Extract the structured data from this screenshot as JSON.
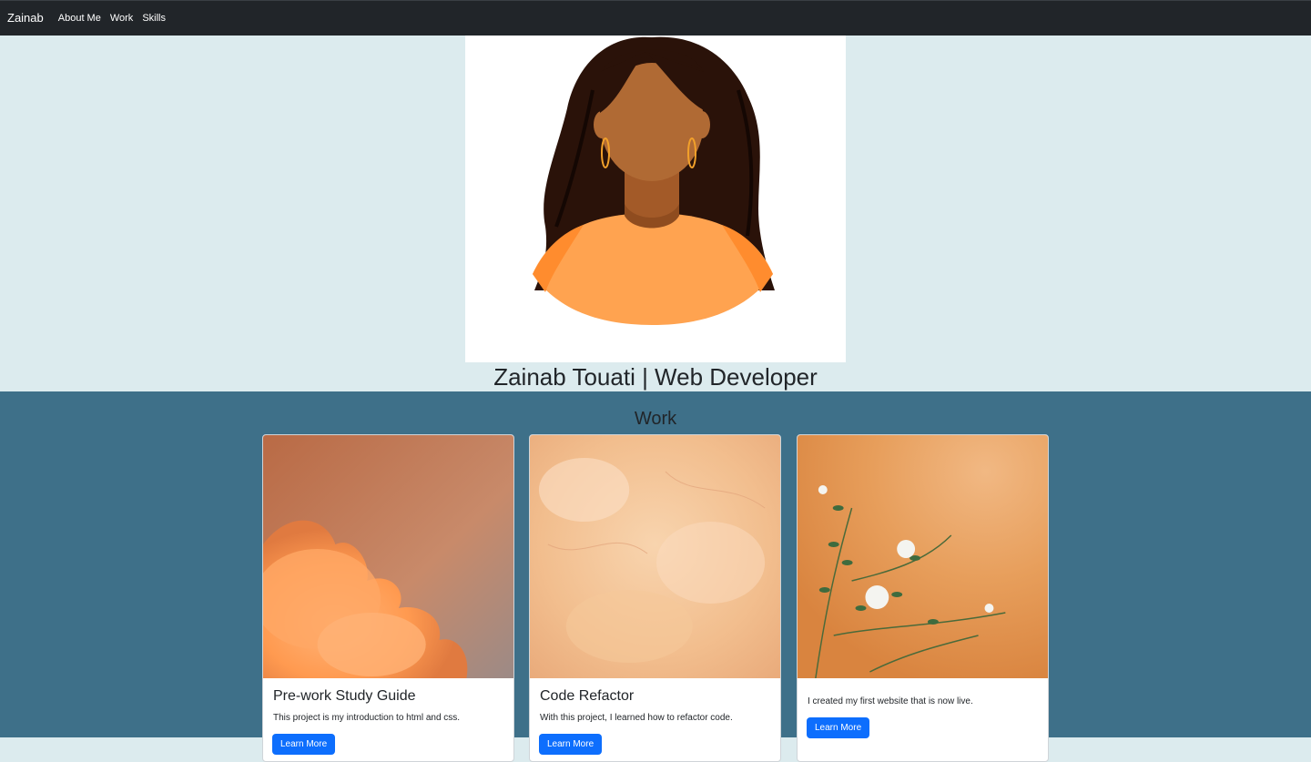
{
  "navbar": {
    "brand": "Zainab",
    "links": [
      "About Me",
      "Work",
      "Skills"
    ]
  },
  "hero": {
    "title": "Zainab Touati | Web Developer"
  },
  "work": {
    "heading": "Work",
    "cards": [
      {
        "title": "Pre-work Study Guide",
        "text": "This project is my introduction to html and css.",
        "button": "Learn More"
      },
      {
        "title": "Code Refactor",
        "text": "With this project, I learned how to refactor code.",
        "button": "Learn More"
      },
      {
        "title": "",
        "text": "I created my first website that is now live.",
        "button": "Learn More"
      }
    ]
  },
  "colors": {
    "navbar": "#212529",
    "hero_bg": "#dcebee",
    "work_bg": "#3e7089",
    "button": "#0d6efd"
  }
}
